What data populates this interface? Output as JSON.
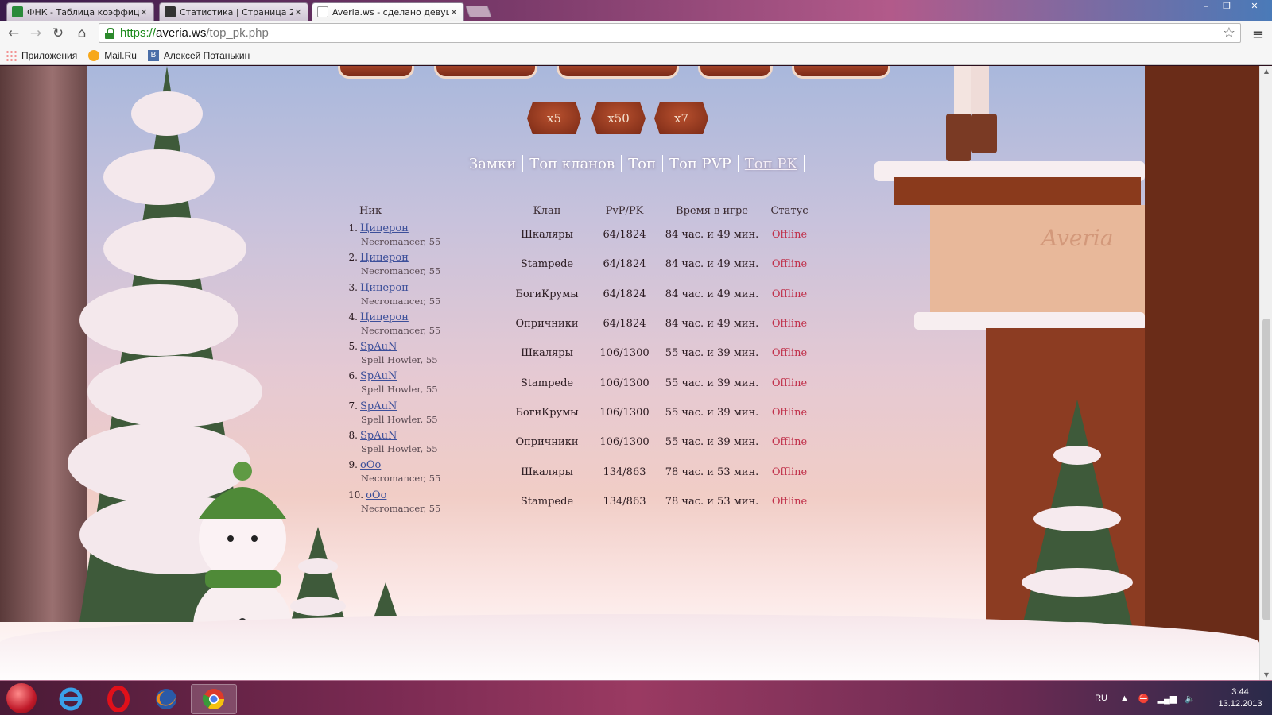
{
  "browser": {
    "tabs": [
      {
        "title": "ФНК - Таблица коэффици",
        "active": false
      },
      {
        "title": "Статистика | Страница 2 |",
        "active": false
      },
      {
        "title": "Averia.ws - сделано девуш",
        "active": true
      }
    ],
    "url": {
      "scheme": "https://",
      "host": "averia.ws",
      "path": "/top_pk.php"
    },
    "bookmarks": [
      {
        "label": "Приложения",
        "icon": "apps-grid-icon"
      },
      {
        "label": "Mail.Ru",
        "icon": "mailru-icon"
      },
      {
        "label": "Алексей Потанькин",
        "icon": "vk-icon"
      }
    ]
  },
  "page": {
    "server_buttons": [
      "x5",
      "x50",
      "x7"
    ],
    "nav": [
      {
        "label": "Замки",
        "current": false
      },
      {
        "label": "Топ кланов",
        "current": false
      },
      {
        "label": "Топ",
        "current": false
      },
      {
        "label": "Топ PVP",
        "current": false
      },
      {
        "label": "Топ PK",
        "current": true
      }
    ],
    "watermark": "Averia",
    "table": {
      "headers": {
        "nick": "Ник",
        "clan": "Клан",
        "pvppk": "PvP/PK",
        "time": "Время в игре",
        "status": "Статус"
      },
      "rows": [
        {
          "rank": "1.",
          "name": "Цицерон",
          "class": "Necromancer, 55",
          "clan": "Шкаляры",
          "pvppk": "64/1824",
          "time": "84 час. и 49 мин.",
          "status": "Offline"
        },
        {
          "rank": "2.",
          "name": "Цицерон",
          "class": "Necromancer, 55",
          "clan": "Stampede",
          "pvppk": "64/1824",
          "time": "84 час. и 49 мин.",
          "status": "Offline"
        },
        {
          "rank": "3.",
          "name": "Цицерон",
          "class": "Necromancer, 55",
          "clan": "БогиКрумы",
          "pvppk": "64/1824",
          "time": "84 час. и 49 мин.",
          "status": "Offline"
        },
        {
          "rank": "4.",
          "name": "Цицерон",
          "class": "Necromancer, 55",
          "clan": "Опричники",
          "pvppk": "64/1824",
          "time": "84 час. и 49 мин.",
          "status": "Offline"
        },
        {
          "rank": "5.",
          "name": "SpAuN",
          "class": "Spell Howler, 55",
          "clan": "Шкаляры",
          "pvppk": "106/1300",
          "time": "55 час. и 39 мин.",
          "status": "Offline"
        },
        {
          "rank": "6.",
          "name": "SpAuN",
          "class": "Spell Howler, 55",
          "clan": "Stampede",
          "pvppk": "106/1300",
          "time": "55 час. и 39 мин.",
          "status": "Offline"
        },
        {
          "rank": "7.",
          "name": "SpAuN",
          "class": "Spell Howler, 55",
          "clan": "БогиКрумы",
          "pvppk": "106/1300",
          "time": "55 час. и 39 мин.",
          "status": "Offline"
        },
        {
          "rank": "8.",
          "name": "SpAuN",
          "class": "Spell Howler, 55",
          "clan": "Опричники",
          "pvppk": "106/1300",
          "time": "55 час. и 39 мин.",
          "status": "Offline"
        },
        {
          "rank": "9.",
          "name": "oOo",
          "class": "Necromancer, 55",
          "clan": "Шкаляры",
          "pvppk": "134/863",
          "time": "78 час. и 53 мин.",
          "status": "Offline"
        },
        {
          "rank": "10.",
          "name": "oOo",
          "class": "Necromancer, 55",
          "clan": "Stampede",
          "pvppk": "134/863",
          "time": "78 час. и 53 мин.",
          "status": "Offline"
        }
      ]
    }
  },
  "taskbar": {
    "apps": [
      "internet-explorer-icon",
      "opera-icon",
      "firefox-icon",
      "chrome-icon"
    ],
    "language": "RU",
    "time": "3:44",
    "date": "13.12.2013"
  },
  "colors": {
    "link": "#3c4f9a",
    "offline": "#c0304a",
    "ssl_green": "#1a8a1a"
  }
}
